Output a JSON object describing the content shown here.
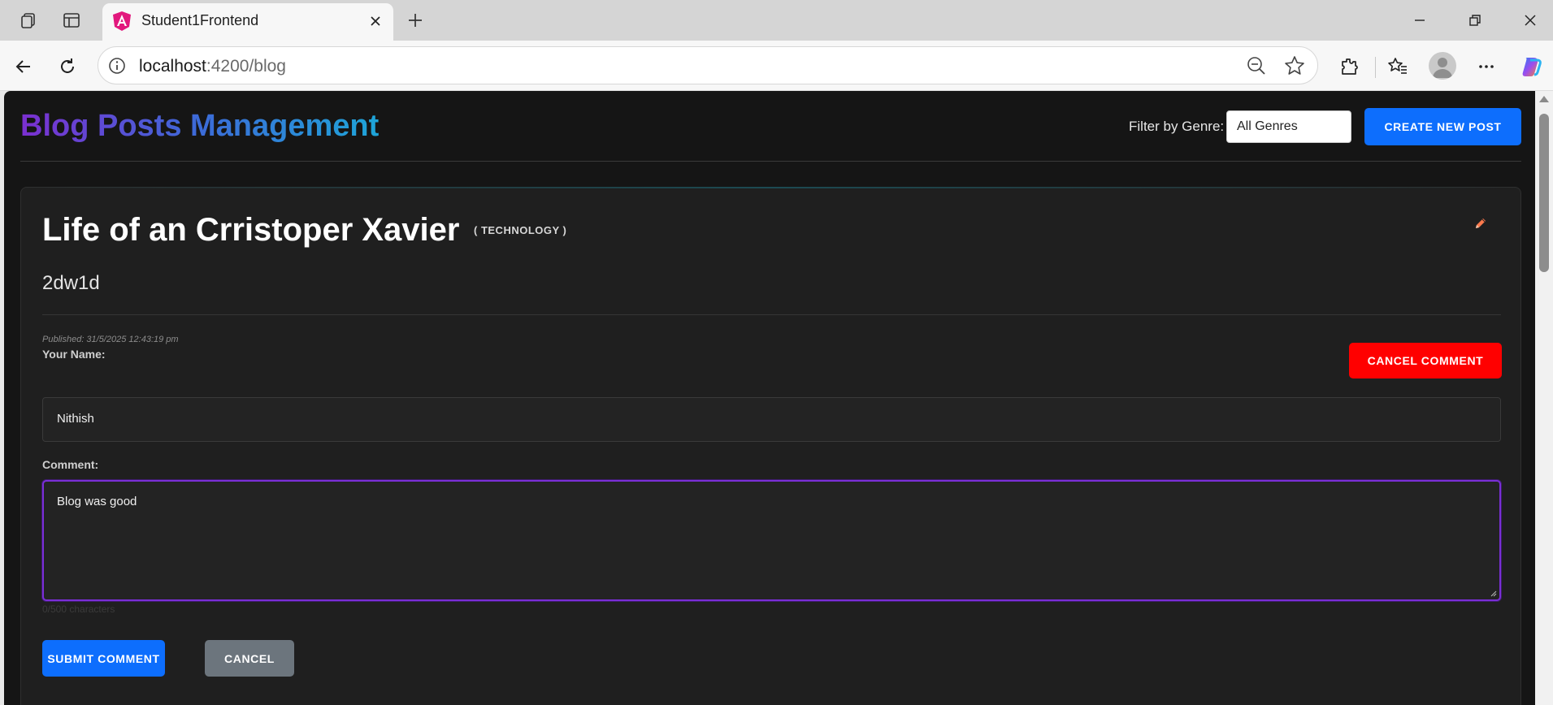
{
  "browser": {
    "tab_title": "Student1Frontend",
    "url_host": "localhost",
    "url_path": ":4200/blog"
  },
  "header": {
    "title": "Blog Posts Management",
    "filter_label": "Filter by Genre:",
    "genre_selected": "All Genres",
    "create_button": "CREATE NEW POST"
  },
  "post": {
    "title": "Life of an Crristoper Xavier",
    "genre": "( TECHNOLOGY )",
    "body": "2dw1d",
    "published": "Published: 31/5/2025 12:43:19 pm"
  },
  "comment_form": {
    "cancel_comment_button": "CANCEL COMMENT",
    "name_label": "Your Name:",
    "name_value": "Nithish",
    "comment_label": "Comment:",
    "comment_value": "Blog was good",
    "hint": "0/500 characters",
    "submit_button": "SUBMIT COMMENT",
    "cancel_button": "CANCEL"
  },
  "colors": {
    "primary": "#0d6efd",
    "danger": "#ff0000",
    "secondary": "#6c757d",
    "focus": "#7a2fd6"
  }
}
